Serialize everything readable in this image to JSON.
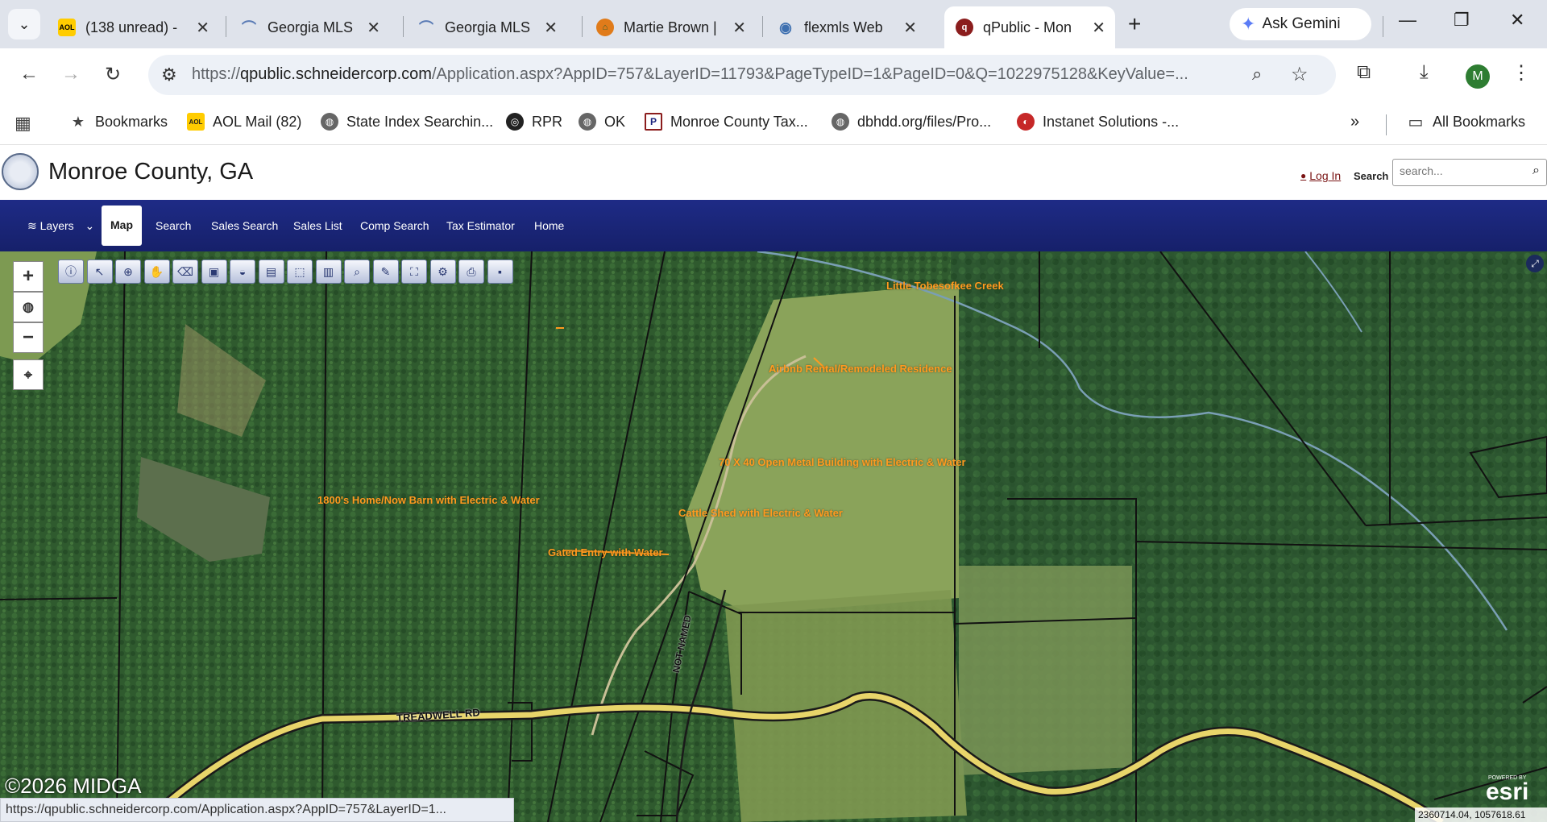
{
  "browser": {
    "tabs": [
      {
        "title": "(138 unread) -",
        "favicon": "AOL",
        "favicon_color": "#ffcc00"
      },
      {
        "title": "Georgia MLS",
        "favicon": "georgia-mls-icon",
        "favicon_color": "#5a7bb5"
      },
      {
        "title": "Georgia MLS",
        "favicon": "georgia-mls-icon",
        "favicon_color": "#5a7bb5"
      },
      {
        "title": "Martie Brown |",
        "favicon": "martie-brown-icon",
        "favicon_color": "#e07b1a"
      },
      {
        "title": "flexmls Web",
        "favicon": "flexmls-icon",
        "favicon_color": "#3d6fb0"
      },
      {
        "title": "qPublic - Mon",
        "favicon": "qpublic-icon",
        "favicon_color": "#8b1d1d"
      }
    ],
    "gemini_label": "Ask Gemini",
    "profile_initial": "M",
    "url": {
      "scheme": "https://",
      "host": "qpublic.schneidercorp.com",
      "rest": "/Application.aspx?AppID=757&LayerID=11793&PageTypeID=1&PageID=0&Q=1022975128&KeyValue=..."
    },
    "bookmarks": [
      {
        "label": "Bookmarks",
        "icon": "star-icon"
      },
      {
        "label": "AOL Mail (82)",
        "icon": "AOL"
      },
      {
        "label": "State Index Searchin...",
        "icon": "globe-icon"
      },
      {
        "label": "RPR",
        "icon": "rpr-icon"
      },
      {
        "label": "OK",
        "icon": "globe-icon"
      },
      {
        "label": "Monroe County Tax...",
        "icon": "qp-icon"
      },
      {
        "label": "dbhdd.org/files/Pro...",
        "icon": "globe-icon"
      },
      {
        "label": "Instanet Solutions -...",
        "icon": "instanet-icon"
      }
    ],
    "all_bookmarks_label": "All Bookmarks",
    "status_url": "https://qpublic.schneidercorp.com/Application.aspx?AppID=757&LayerID=1..."
  },
  "site": {
    "title": "Monroe County, GA",
    "login_label": "Log In",
    "search_label": "Search",
    "search_placeholder": "search...",
    "nav": [
      {
        "label": "Layers",
        "key": "layers"
      },
      {
        "label": "Map",
        "key": "map"
      },
      {
        "label": "Search",
        "key": "search"
      },
      {
        "label": "Sales Search",
        "key": "sales-search"
      },
      {
        "label": "Sales List",
        "key": "sales-list"
      },
      {
        "label": "Comp Search",
        "key": "comp-search"
      },
      {
        "label": "Tax Estimator",
        "key": "tax-estimator"
      },
      {
        "label": "Home",
        "key": "home"
      }
    ]
  },
  "map": {
    "labels": {
      "creek": "Little Tobesofkee Creek",
      "airbnb": "Airbnb Rental/Remodeled Residence",
      "metal_building": "70 X 40 Open Metal Building with Electric & Water",
      "home_barn": "1800's Home/Now Barn with Electric & Water",
      "cattle_shed": "Cattle Shed with Electric & Water",
      "gated_entry": "Gated Entry with Water",
      "road_treadwell": "TREADWELL RD",
      "road_not_named": "NOT NAMED"
    },
    "copyright": "©2026 MIDGA",
    "esri_powered": "POWERED BY",
    "esri_mark": "esri",
    "coordinates": "2360714.04, 1057618.61"
  }
}
